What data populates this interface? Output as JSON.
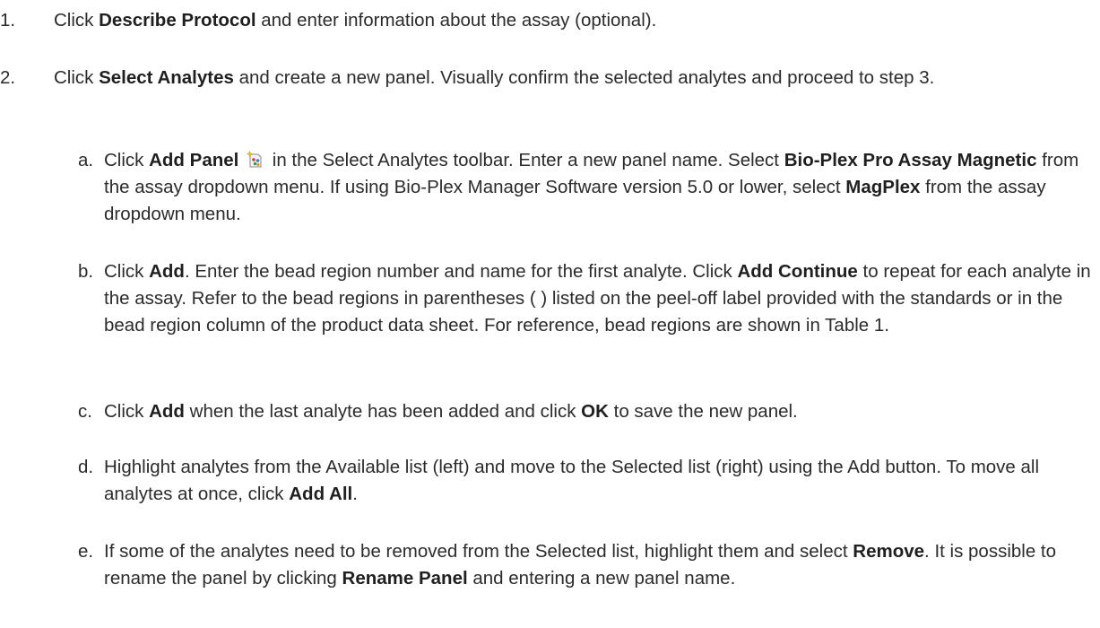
{
  "steps": [
    {
      "num": "1.",
      "parts": [
        {
          "t": "Click "
        },
        {
          "t": "Describe Protocol",
          "b": true
        },
        {
          "t": " and enter information about the assay (optional)."
        }
      ]
    },
    {
      "num": "2.",
      "parts": [
        {
          "t": "Click "
        },
        {
          "t": "Select Analytes",
          "b": true
        },
        {
          "t": " and create a new panel. Visually confirm the selected analytes and proceed to step 3."
        }
      ]
    }
  ],
  "substeps": [
    {
      "num": "a.",
      "parts": [
        {
          "t": "Click "
        },
        {
          "t": "Add Panel",
          "b": true
        },
        {
          "icon": "add-panel-icon"
        },
        {
          "t": " in the Select Analytes toolbar. Enter a new panel name. Select "
        },
        {
          "t": "Bio-Plex Pro Assay Magnetic",
          "b": true
        },
        {
          "t": " from the assay dropdown menu. If using Bio-Plex Manager Software version 5.0 or lower, select "
        },
        {
          "t": "MagPlex",
          "b": true
        },
        {
          "t": " from the assay dropdown menu."
        }
      ]
    },
    {
      "num": "b.",
      "parts": [
        {
          "t": "Click "
        },
        {
          "t": "Add",
          "b": true
        },
        {
          "t": ". Enter the bead region number and name for the first analyte. Click "
        },
        {
          "t": "Add Continue",
          "b": true
        },
        {
          "t": " to repeat for each analyte in the assay. Refer to the bead regions in parentheses ( ) listed on the peel-off label provided with the standards or in the bead region column of the product data sheet. For reference, bead regions are shown in Table 1."
        }
      ]
    },
    {
      "num": "c.",
      "parts": [
        {
          "t": "Click "
        },
        {
          "t": "Add",
          "b": true
        },
        {
          "t": " when the last analyte has been added and click "
        },
        {
          "t": "OK",
          "b": true
        },
        {
          "t": " to save the new panel."
        }
      ]
    },
    {
      "num": "d.",
      "parts": [
        {
          "t": "Highlight analytes from the Available list (left) and move to the Selected list (right) using the Add button. To move all analytes at once, click "
        },
        {
          "t": "Add All",
          "b": true
        },
        {
          "t": "."
        }
      ]
    },
    {
      "num": "e.",
      "parts": [
        {
          "t": "If some of the analytes need to be removed from the Selected list, highlight them and select "
        },
        {
          "t": "Remove",
          "b": true
        },
        {
          "t": ". It is possible to rename the panel by clicking "
        },
        {
          "t": "Rename Panel",
          "b": true
        },
        {
          "t": " and entering a new panel name."
        }
      ]
    }
  ]
}
